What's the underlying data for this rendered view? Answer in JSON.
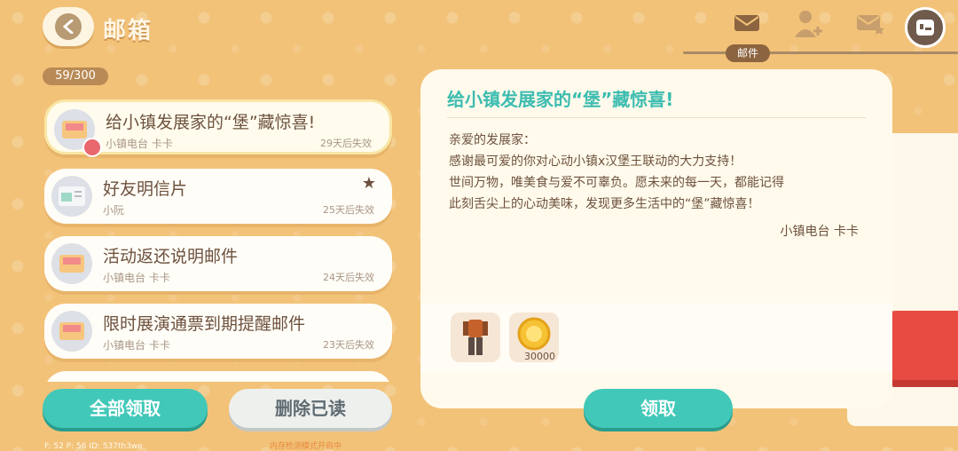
{
  "header": {
    "title": "邮箱",
    "count": "59/300",
    "active_tab_label": "邮件"
  },
  "mails": [
    {
      "title": "给小镇发展家的“堡”藏惊喜!",
      "sender": "小镇电台 卡卡",
      "expire": "29天后失效"
    },
    {
      "title": "好友明信片",
      "sender": "小阮",
      "expire": "25天后失效"
    },
    {
      "title": "活动返还说明邮件",
      "sender": "小镇电台 卡卡",
      "expire": "24天后失效"
    },
    {
      "title": "限时展演通票到期提醒邮件",
      "sender": "小镇电台 卡卡",
      "expire": "23天后失效"
    }
  ],
  "buttons": {
    "claim_all": "全部领取",
    "delete_read": "删除已读",
    "claim": "领取"
  },
  "detail": {
    "title": "给小镇发展家的“堡”藏惊喜!",
    "greeting": "亲爱的发展家：",
    "line1": "感谢最可爱的你对心动小镇x汉堡王联动的大力支持！",
    "line2": "世间万物，唯美食与爱不可辜负。愿未来的每一天，都能记得",
    "line3": "此刻舌尖上的心动美味，发现更多生活中的“堡”藏惊喜！",
    "signature": "小镇电台 卡卡",
    "reward_coin_count": "30000"
  },
  "footer": {
    "info": "F: 52   P: 56   ID: 537th3we",
    "warn": "内存检测模式开启中"
  }
}
